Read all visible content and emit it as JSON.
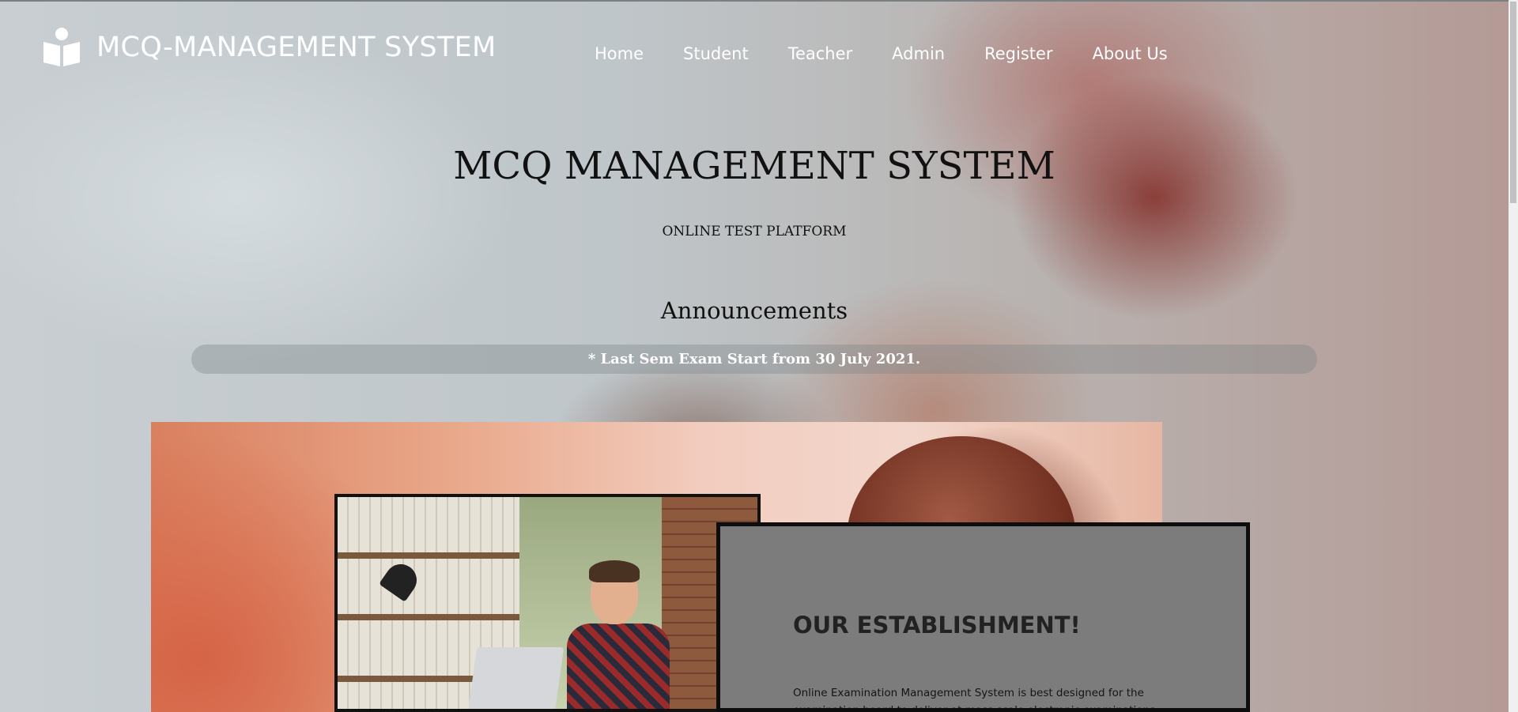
{
  "header": {
    "brand": "MCQ-MANAGEMENT SYSTEM",
    "brand_icon": "reader-icon",
    "nav": [
      {
        "label": "Home"
      },
      {
        "label": "Student"
      },
      {
        "label": "Teacher"
      },
      {
        "label": "Admin"
      },
      {
        "label": "Register"
      },
      {
        "label": "About Us"
      }
    ]
  },
  "hero": {
    "title": "MCQ MANAGEMENT SYSTEM",
    "subtitle": "ONLINE TEST PLATFORM"
  },
  "announcements": {
    "title": "Announcements",
    "items": [
      "* Last Sem Exam Start from 30 July 2021."
    ]
  },
  "establishment": {
    "title": "OUR ESTABLISHMENT!",
    "text": "Online Examination Management System is best designed for the examination board to deliver at mass scale electronic examinations and"
  },
  "colors": {
    "nav_text": "#ffffff",
    "title_text": "#111111",
    "card_bg": "#7c7c7c"
  }
}
